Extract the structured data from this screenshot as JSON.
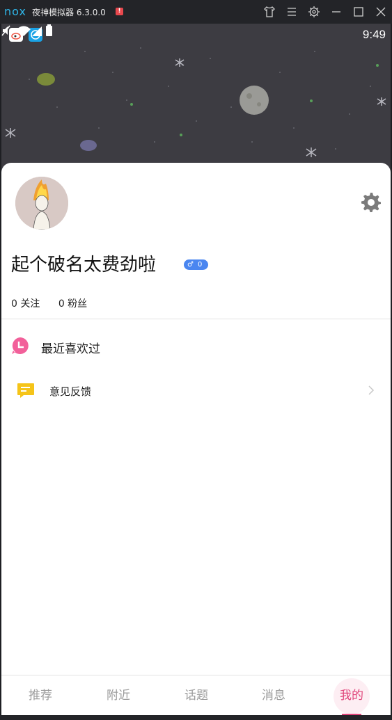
{
  "emulator": {
    "logo": "nox",
    "title": "夜神模拟器 6.3.0.0",
    "alert_badge": "!"
  },
  "status_bar": {
    "time": "9:49"
  },
  "profile": {
    "username": "起个破名太费劲啦",
    "gender_symbol": "♂",
    "gender_count": "0",
    "following": "0 关注",
    "followers": "0 粉丝"
  },
  "menu": {
    "recent_likes": "最近喜欢过",
    "feedback": "意见反馈"
  },
  "tabs": [
    {
      "label": "推荐"
    },
    {
      "label": "附近"
    },
    {
      "label": "话题"
    },
    {
      "label": "消息"
    },
    {
      "label": "我的"
    }
  ],
  "colors": {
    "accent": "#e0447a",
    "gender_badge": "#4a86f0",
    "recent_icon": "#f2609a",
    "feedback_icon": "#f5c419"
  }
}
